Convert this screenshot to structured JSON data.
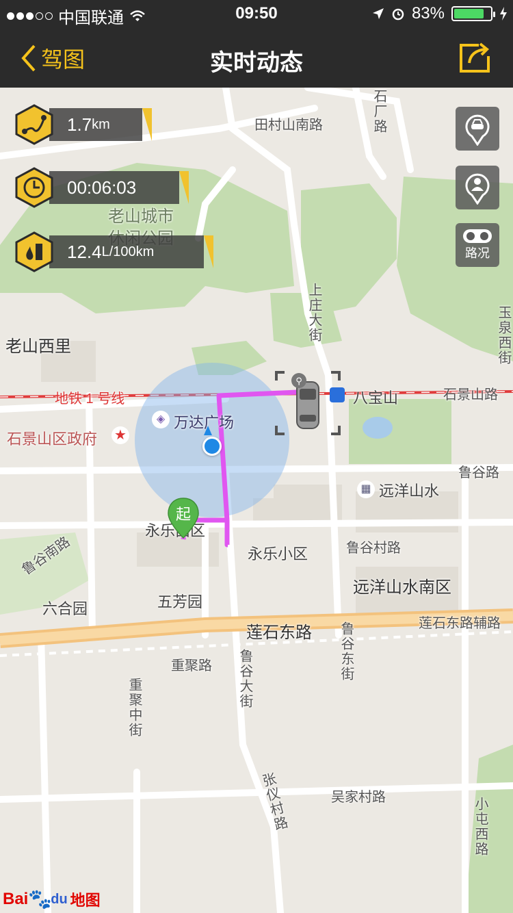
{
  "status_bar": {
    "carrier": "中国联通",
    "time": "09:50",
    "battery": "83%",
    "battery_level": 0.83
  },
  "nav": {
    "back_label": "驾图",
    "title": "实时动态"
  },
  "stats": {
    "distance_value": "1.7",
    "distance_unit": "km",
    "duration": "00:06:03",
    "fuel_value": "12.4",
    "fuel_unit": "L/100km"
  },
  "buttons": {
    "traffic_label": "路况"
  },
  "map_labels": {
    "tiancun": "田村山南路",
    "shichang": "石厂路",
    "park": "老山城市",
    "park2": "休闲公园",
    "laoshan": "老山西里",
    "shangzhuang": "上庄大街",
    "yuquan": "玉泉西街",
    "subway": "地铁 1 号线",
    "babaoshan": "八宝山",
    "shijingshan_rd": "石景山路",
    "gov": "石景山区政府",
    "wanda": "万达广场",
    "luguroad": "鲁谷路",
    "yuanyang": "远洋山水",
    "yongle": "永乐西区",
    "yongle_xiaoqu": "永乐小区",
    "lugucun": "鲁谷村路",
    "yuanyang_south": "远洋山水南区",
    "lugunan": "鲁谷南路",
    "liuheyuan": "六合园",
    "wufangyuan": "五芳园",
    "lianshi_e": "莲石东路",
    "lianshi_aux": "莲石东路辅路",
    "ludong": "鲁谷东街",
    "chongju": "重聚路",
    "ludajie": "鲁谷大街",
    "chongju_zj": "重聚中街",
    "zhangyi": "张仪村路",
    "wujia": "吴家村路",
    "xiaotun": "小屯西路",
    "start": "起"
  },
  "logo": {
    "brand": "Bai",
    "brand2": "du",
    "map": "地图"
  },
  "colors": {
    "accent": "#f6c31b",
    "route": "#e056f0",
    "location": "#1e88e5",
    "start_pin": "#55b64a"
  }
}
